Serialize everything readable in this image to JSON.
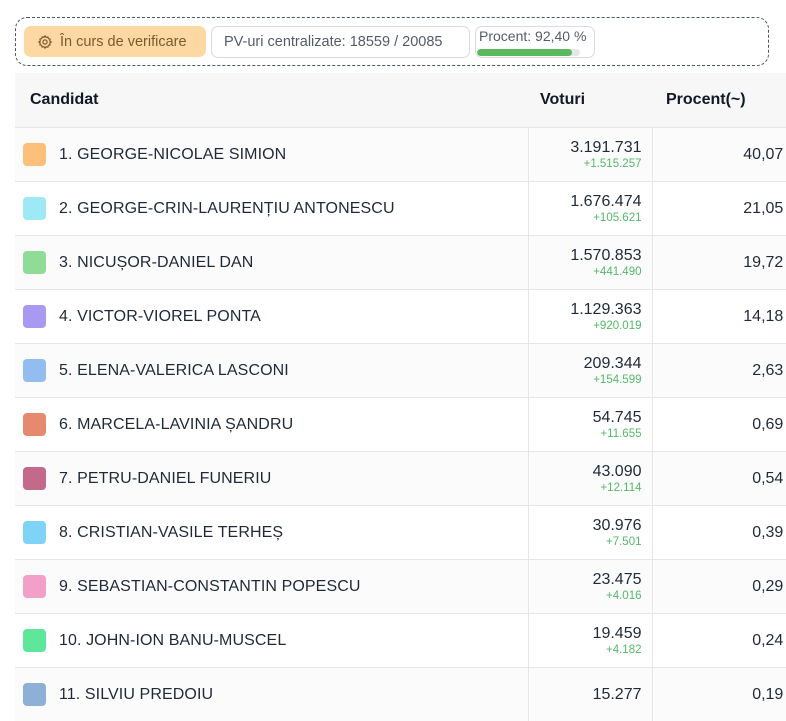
{
  "status": {
    "badge_label": "În curs de verificare",
    "pv_text": "PV-uri centralizate: 18559 / 20085",
    "percent_text": "Procent: 92,40 %",
    "percent_value": 92.4
  },
  "table": {
    "headers": {
      "candidate": "Candidat",
      "votes": "Voturi",
      "percent": "Procent(~)"
    },
    "rows": [
      {
        "name": "1. GEORGE-NICOLAE SIMION",
        "votes": "3.191.731",
        "delta": "+1.515.257",
        "percent": "40,07 %",
        "color": "#fdc07a"
      },
      {
        "name": "2. GEORGE-CRIN-LAURENȚIU ANTONESCU",
        "votes": "1.676.474",
        "delta": "+105.621",
        "percent": "21,05 %",
        "color": "#9de9f4"
      },
      {
        "name": "3. NICUȘOR-DANIEL DAN",
        "votes": "1.570.853",
        "delta": "+441.490",
        "percent": "19,72 %",
        "color": "#8fdc96"
      },
      {
        "name": "4. VICTOR-VIOREL PONTA",
        "votes": "1.129.363",
        "delta": "+920.019",
        "percent": "14,18 %",
        "color": "#a999f0"
      },
      {
        "name": "5. ELENA-VALERICA LASCONI",
        "votes": "209.344",
        "delta": "+154.599",
        "percent": "2,63 %",
        "color": "#93bdf0"
      },
      {
        "name": "6. MARCELA-LAVINIA ȘANDRU",
        "votes": "54.745",
        "delta": "+11.655",
        "percent": "0,69 %",
        "color": "#e58a6e"
      },
      {
        "name": "7. PETRU-DANIEL FUNERIU",
        "votes": "43.090",
        "delta": "+12.114",
        "percent": "0,54 %",
        "color": "#c36a8a"
      },
      {
        "name": "8. CRISTIAN-VASILE TERHEȘ",
        "votes": "30.976",
        "delta": "+7.501",
        "percent": "0,39 %",
        "color": "#7fd3f7"
      },
      {
        "name": "9. SEBASTIAN-CONSTANTIN POPESCU",
        "votes": "23.475",
        "delta": "+4.016",
        "percent": "0,29 %",
        "color": "#f3a0c8"
      },
      {
        "name": "10. JOHN-ION BANU-MUSCEL",
        "votes": "19.459",
        "delta": "+4.182",
        "percent": "0,24 %",
        "color": "#5ee69a"
      },
      {
        "name": "11. SILVIU PREDOIU",
        "votes": "15.277",
        "delta": "",
        "percent": "0,19 %",
        "color": "#8fb0d6"
      }
    ]
  }
}
